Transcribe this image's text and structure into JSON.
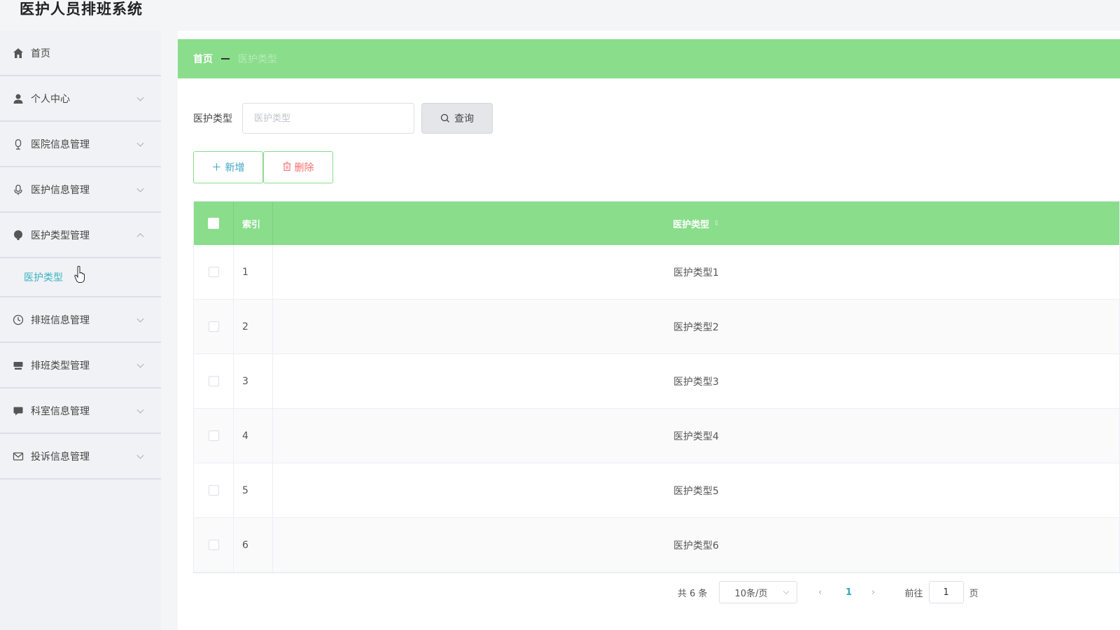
{
  "app": {
    "title": "医护人员排班系统"
  },
  "sidebar": {
    "items": [
      {
        "label": "首页",
        "icon": "home-icon"
      },
      {
        "label": "个人中心",
        "icon": "user-icon"
      },
      {
        "label": "医院信息管理",
        "icon": "hospital-icon"
      },
      {
        "label": "医护信息管理",
        "icon": "nurse-icon"
      },
      {
        "label": "医护类型管理",
        "icon": "category-icon",
        "expanded": true,
        "children": [
          {
            "label": "医护类型",
            "active": true
          }
        ]
      },
      {
        "label": "排班信息管理",
        "icon": "clock-icon"
      },
      {
        "label": "排班类型管理",
        "icon": "schedule-type-icon"
      },
      {
        "label": "科室信息管理",
        "icon": "department-icon"
      },
      {
        "label": "投诉信息管理",
        "icon": "mail-icon"
      }
    ]
  },
  "breadcrumb": {
    "home": "首页",
    "current": "医护类型"
  },
  "search": {
    "label": "医护类型",
    "placeholder": "医护类型",
    "value": "",
    "button": "查询"
  },
  "actions": {
    "add": "新增",
    "delete": "删除"
  },
  "table": {
    "columns": [
      "索引",
      "医护类型"
    ],
    "rows": [
      {
        "index": "1",
        "type": "医护类型1"
      },
      {
        "index": "2",
        "type": "医护类型2"
      },
      {
        "index": "3",
        "type": "医护类型3"
      },
      {
        "index": "4",
        "type": "医护类型4"
      },
      {
        "index": "5",
        "type": "医护类型5"
      },
      {
        "index": "6",
        "type": "医护类型6"
      }
    ]
  },
  "pagination": {
    "total": "共 6 条",
    "page_size": "10条/页",
    "current_page": "1",
    "goto_label": "前往",
    "goto_value": "1",
    "goto_suffix": "页"
  },
  "colors": {
    "accent": "#89dd8b",
    "link": "#3aa4c5",
    "danger": "#f56c6c",
    "submenu_active": "#3bb3c3"
  }
}
